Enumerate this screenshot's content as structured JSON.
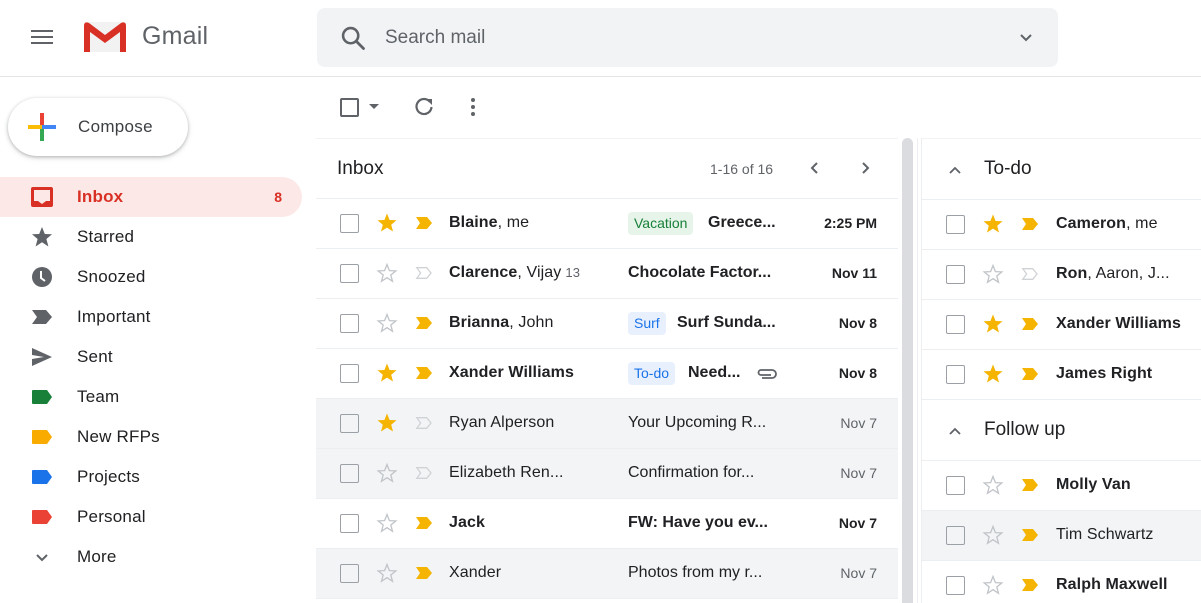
{
  "header": {
    "app_name": "Gmail",
    "search_placeholder": "Search mail"
  },
  "colors": {
    "accent_red": "#d93025",
    "active_bg": "#fce8e6",
    "star_yellow": "#f4b400",
    "important_yellow": "#f4b400",
    "label_team": "#188038",
    "label_new_rfps": "#f9ab00",
    "label_projects": "#1a73e8",
    "label_personal": "#ea4335"
  },
  "compose": {
    "label": "Compose"
  },
  "sidebar": {
    "items": [
      {
        "label": "Inbox",
        "icon": "inbox-icon",
        "count": "8",
        "active": true
      },
      {
        "label": "Starred",
        "icon": "star-icon"
      },
      {
        "label": "Snoozed",
        "icon": "clock-icon"
      },
      {
        "label": "Important",
        "icon": "important-icon"
      },
      {
        "label": "Sent",
        "icon": "send-icon"
      },
      {
        "label": "Team",
        "icon": "label-icon",
        "color": "#188038"
      },
      {
        "label": "New RFPs",
        "icon": "label-icon",
        "color": "#f9ab00"
      },
      {
        "label": "Projects",
        "icon": "label-icon",
        "color": "#1a73e8"
      },
      {
        "label": "Personal",
        "icon": "label-icon",
        "color": "#ea4335"
      },
      {
        "label": "More",
        "icon": "chevron-down-icon"
      }
    ]
  },
  "inbox": {
    "title": "Inbox",
    "pager": "1-16 of 16",
    "rows": [
      {
        "sender_bold": "Blaine",
        "sender_rest": ", me",
        "count": "",
        "tag": "Vacation",
        "tag_bg": "#e6f4ea",
        "tag_color": "#188038",
        "subject": "Greece...",
        "date": "2:25 PM",
        "starred": true,
        "important": true,
        "unread": true,
        "attachment": false
      },
      {
        "sender_bold": "Clarence",
        "sender_rest": ", Vijay",
        "count": "13",
        "tag": "",
        "subject": "Chocolate Factor...",
        "date": "Nov 11",
        "starred": false,
        "important": false,
        "unread": true,
        "attachment": false
      },
      {
        "sender_bold": "Brianna",
        "sender_rest": ", John",
        "count": "",
        "tag": "Surf",
        "tag_bg": "#e8f0fe",
        "tag_color": "#1a73e8",
        "subject": "Surf Sunda...",
        "date": "Nov 8",
        "starred": false,
        "important": true,
        "unread": true,
        "attachment": false
      },
      {
        "sender_bold": "Xander Williams",
        "sender_rest": "",
        "count": "",
        "tag": "To-do",
        "tag_bg": "#e8f0fe",
        "tag_color": "#1a73e8",
        "subject": "Need...",
        "date": "Nov 8",
        "starred": true,
        "important": true,
        "unread": true,
        "attachment": true
      },
      {
        "sender_bold": "",
        "sender_rest": "Ryan Alperson",
        "count": "",
        "tag": "",
        "subject": "Your Upcoming R...",
        "date": "Nov 7",
        "starred": true,
        "important": false,
        "unread": false,
        "attachment": false
      },
      {
        "sender_bold": "",
        "sender_rest": "Elizabeth Ren...",
        "count": "",
        "tag": "",
        "subject": "Confirmation for...",
        "date": "Nov 7",
        "starred": false,
        "important": false,
        "unread": false,
        "attachment": false
      },
      {
        "sender_bold": "Jack",
        "sender_rest": "",
        "count": "",
        "tag": "",
        "subject": "FW: Have you ev...",
        "date": "Nov 7",
        "starred": false,
        "important": true,
        "unread": true,
        "attachment": false
      },
      {
        "sender_bold": "",
        "sender_rest": "Xander",
        "count": "",
        "tag": "",
        "subject": "Photos from my r...",
        "date": "Nov 7",
        "starred": false,
        "important": true,
        "unread": false,
        "attachment": false
      }
    ]
  },
  "right_panel": {
    "sections": [
      {
        "title": "To-do",
        "rows": [
          {
            "sender_bold": "Cameron",
            "sender_rest": ", me",
            "starred": true,
            "important": true,
            "unread": true
          },
          {
            "sender_bold": "Ron",
            "sender_rest": ", Aaron, J...",
            "starred": false,
            "important": false,
            "unread": true
          },
          {
            "sender_bold": "Xander Williams",
            "sender_rest": "",
            "starred": true,
            "important": true,
            "unread": true
          },
          {
            "sender_bold": "James Right",
            "sender_rest": "",
            "starred": true,
            "important": true,
            "unread": true
          }
        ]
      },
      {
        "title": "Follow up",
        "rows": [
          {
            "sender_bold": "Molly Van",
            "sender_rest": "",
            "starred": false,
            "important": true,
            "unread": true
          },
          {
            "sender_bold": "",
            "sender_rest": "Tim Schwartz",
            "starred": false,
            "important": true,
            "unread": false
          },
          {
            "sender_bold": "Ralph Maxwell",
            "sender_rest": "",
            "starred": false,
            "important": true,
            "unread": true
          }
        ]
      }
    ]
  }
}
